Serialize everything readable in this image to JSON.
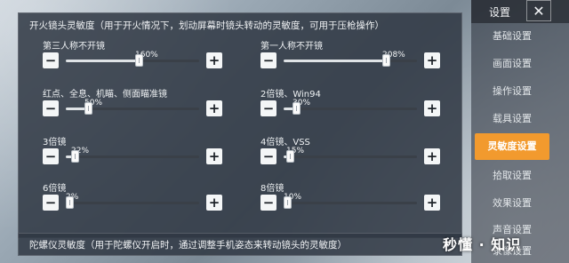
{
  "fire_section": {
    "title": "开火镜头灵敏度（用于开火情况下，划动屏幕时镜头转动的灵敏度，可用于压枪操作）",
    "sliders": [
      {
        "label": "第三人称不开镜",
        "value": "160%",
        "fraction": 0.55
      },
      {
        "label": "第一人称不开镜",
        "value": "208%",
        "fraction": 0.79
      },
      {
        "label": "红点、全息、机瞄、侧面瞄准镜",
        "value": "50%",
        "fraction": 0.15
      },
      {
        "label": "2倍镜、Win94",
        "value": "30%",
        "fraction": 0.07
      },
      {
        "label": "3倍镜",
        "value": "22%",
        "fraction": 0.04
      },
      {
        "label": "4倍镜、VSS",
        "value": "15%",
        "fraction": 0.02
      },
      {
        "label": "6倍镜",
        "value": "2%",
        "fraction": 0.0
      },
      {
        "label": "8倍镜",
        "value": "10%",
        "fraction": 0.0
      }
    ],
    "minus_glyph": "−",
    "plus_glyph": "+"
  },
  "gyro_section": {
    "title": "陀螺仪灵敏度（用于陀螺仪开启时，通过调整手机姿态来转动镜头的灵敏度）"
  },
  "sidebar": {
    "title": "设置",
    "close_glyph": "✕",
    "items": [
      {
        "label": "基础设置",
        "active": false
      },
      {
        "label": "画面设置",
        "active": false
      },
      {
        "label": "操作设置",
        "active": false
      },
      {
        "label": "载具设置",
        "active": false
      },
      {
        "label": "灵敏度设置",
        "active": true
      },
      {
        "label": "拾取设置",
        "active": false
      },
      {
        "label": "效果设置",
        "active": false
      },
      {
        "label": "声音设置",
        "active": false
      },
      {
        "label": "录像设置",
        "active": false
      }
    ]
  },
  "watermark": "秒懂 · 知识",
  "colors": {
    "accent": "#f29a2e",
    "panel": "#303844",
    "button": "#f4f6f7"
  }
}
